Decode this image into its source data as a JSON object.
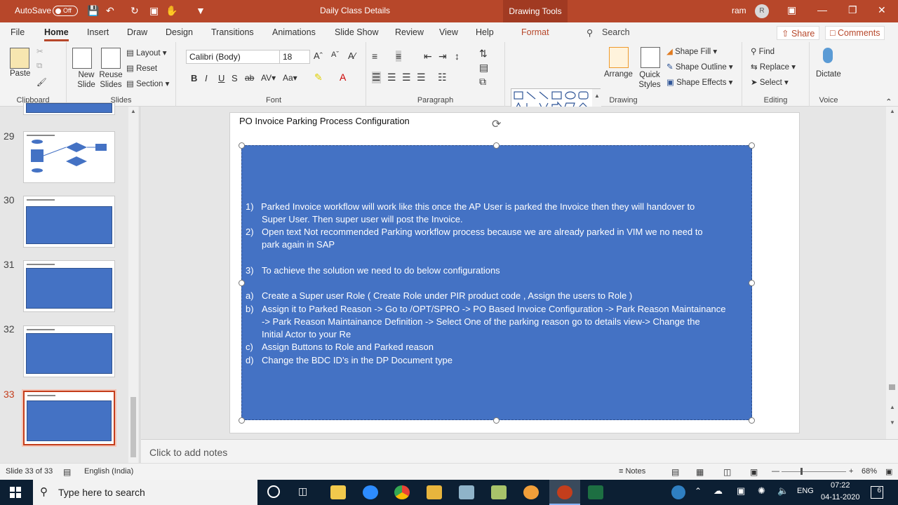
{
  "titlebar": {
    "autosave_label": "AutoSave",
    "autosave_state": "Off",
    "doc_title": "Daily Class Details",
    "context_tab": "Drawing Tools",
    "user_name": "ram",
    "user_initial": "R"
  },
  "menu": {
    "tabs": [
      "File",
      "Home",
      "Insert",
      "Draw",
      "Design",
      "Transitions",
      "Animations",
      "Slide Show",
      "Review",
      "View",
      "Help"
    ],
    "format_tab": "Format",
    "search_label": "Search",
    "share_label": "Share",
    "comments_label": "Comments"
  },
  "ribbon": {
    "clipboard": {
      "paste": "Paste",
      "group": "Clipboard"
    },
    "slides": {
      "new_slide": "New Slide",
      "reuse_slides": "Reuse Slides",
      "layout": "Layout",
      "reset": "Reset",
      "section": "Section",
      "group": "Slides"
    },
    "font": {
      "font_name": "Calibri (Body)",
      "font_size": "18",
      "group": "Font"
    },
    "paragraph": {
      "group": "Paragraph"
    },
    "drawing": {
      "arrange": "Arrange",
      "quick_styles": "Quick Styles",
      "shape_fill": "Shape Fill",
      "shape_outline": "Shape Outline",
      "shape_effects": "Shape Effects",
      "group": "Drawing"
    },
    "editing": {
      "find": "Find",
      "replace": "Replace",
      "select": "Select",
      "group": "Editing"
    },
    "voice": {
      "dictate": "Dictate",
      "group": "Voice"
    }
  },
  "thumbnails": [
    {
      "number": "29"
    },
    {
      "number": "30"
    },
    {
      "number": "31"
    },
    {
      "number": "32"
    },
    {
      "number": "33",
      "selected": true
    }
  ],
  "slide": {
    "title": "PO Invoice Parking Process Configuration",
    "box_color": "#4472c4",
    "items": [
      {
        "num": "1)",
        "text": " Parked Invoice workflow will work like this once the AP User is parked the Invoice then they will handover to"
      },
      {
        "num": "",
        "text": "Super User. Then super user will post the Invoice."
      },
      {
        "num": "2)",
        "text": "Open text Not recommended Parking workflow process because we are already parked in VIM we no need to"
      },
      {
        "num": "",
        "text": "park again in SAP"
      },
      {
        "num": "3)",
        "text": "To achieve the solution we need to do below configurations"
      },
      {
        "num": "a)",
        "text": "Create a Super user Role ( Create Role under PIR  product code , Assign the users to Role )"
      },
      {
        "num": "b)",
        "text": "Assign it to Parked Reason ->  Go to /OPT/SPRO -> PO Based Invoice Configuration -> Park Reason Maintainance"
      },
      {
        "num": "",
        "text": "-> Park Reason Maintainance Definition -> Select One of the parking reason go to details view-> Change the"
      },
      {
        "num": "",
        "text": "Initial Actor to your Re"
      },
      {
        "num": "c)",
        "text": "Assign Buttons to Role and Parked reason"
      },
      {
        "num": "d)",
        "text": "Change the BDC ID’s in the DP Document type"
      }
    ]
  },
  "notes_placeholder": "Click to add notes",
  "status": {
    "slide_count": "Slide 33 of 33",
    "language": "English (India)",
    "notes": "Notes",
    "zoom": "68%"
  },
  "taskbar": {
    "search_placeholder": "Type here to search",
    "lang": "ENG",
    "time": "07:22",
    "date": "04-11-2020",
    "notification_count": "6"
  }
}
